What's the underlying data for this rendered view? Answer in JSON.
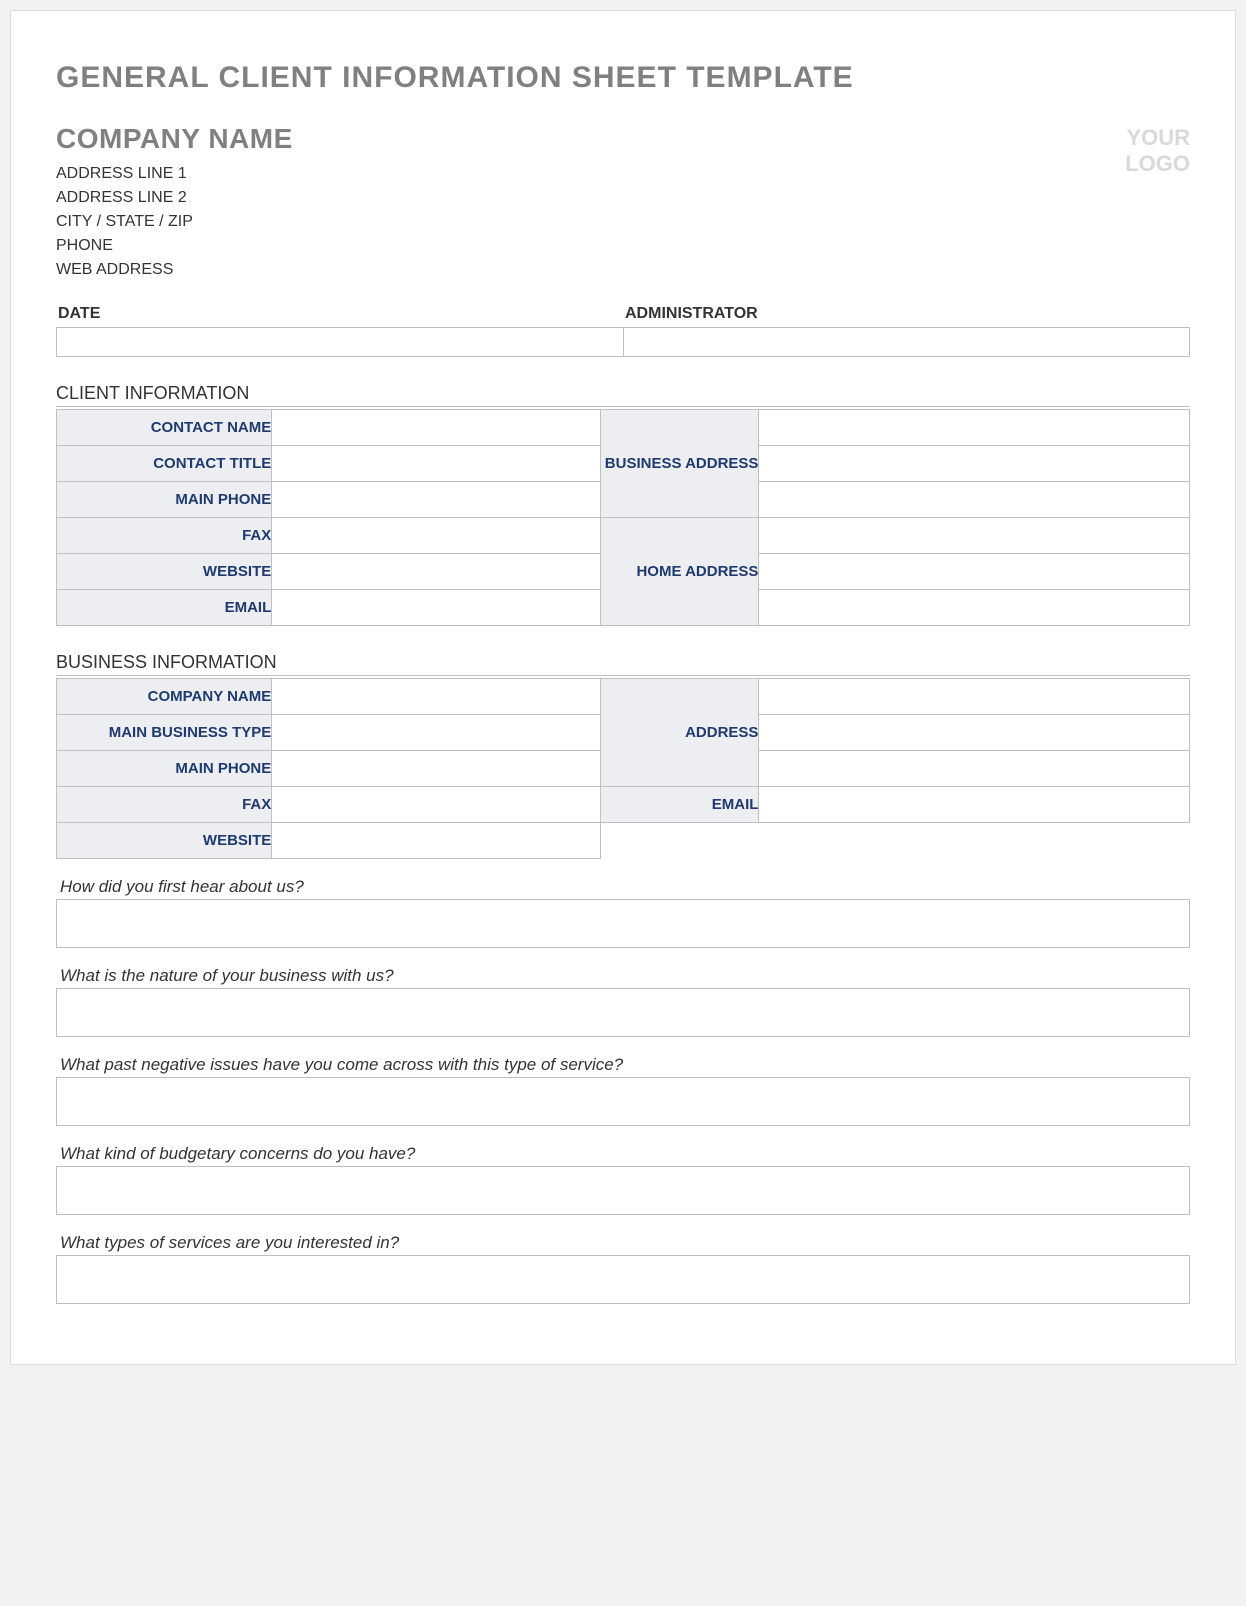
{
  "doc_title": "GENERAL CLIENT INFORMATION SHEET TEMPLATE",
  "company": {
    "name": "COMPANY NAME",
    "address1": "ADDRESS LINE 1",
    "address2": "ADDRESS LINE 2",
    "city_state_zip": "CITY / STATE / ZIP",
    "phone": "PHONE",
    "web": "WEB ADDRESS",
    "logo_line1": "YOUR",
    "logo_line2": "LOGO"
  },
  "date_admin": {
    "date_label": "DATE",
    "admin_label": "ADMINISTRATOR",
    "date_value": "",
    "admin_value": ""
  },
  "client_info": {
    "heading": "CLIENT INFORMATION",
    "contact_name_label": "CONTACT NAME",
    "contact_title_label": "CONTACT TITLE",
    "main_phone_label": "MAIN PHONE",
    "fax_label": "FAX",
    "website_label": "WEBSITE",
    "email_label": "EMAIL",
    "business_address_label": "BUSINESS ADDRESS",
    "home_address_label": "HOME ADDRESS",
    "contact_name": "",
    "contact_title": "",
    "main_phone": "",
    "fax": "",
    "website": "",
    "email": "",
    "business_address1": "",
    "business_address2": "",
    "business_address3": "",
    "home_address1": "",
    "home_address2": "",
    "home_address3": ""
  },
  "business_info": {
    "heading": "BUSINESS INFORMATION",
    "company_name_label": "COMPANY NAME",
    "business_type_label": "MAIN BUSINESS TYPE",
    "main_phone_label": "MAIN PHONE",
    "fax_label": "FAX",
    "website_label": "WEBSITE",
    "address_label": "ADDRESS",
    "email_label": "EMAIL",
    "company_name": "",
    "business_type": "",
    "main_phone": "",
    "fax": "",
    "website": "",
    "address1": "",
    "address2": "",
    "address3": "",
    "email": ""
  },
  "questions": {
    "q1": "How did you first hear about us?",
    "q2": "What is the nature of your business with us?",
    "q3": "What past negative issues have you come across with this type of service?",
    "q4": "What kind of budgetary concerns do you have?",
    "q5": "What types of services are you interested in?",
    "a1": "",
    "a2": "",
    "a3": "",
    "a4": "",
    "a5": ""
  }
}
